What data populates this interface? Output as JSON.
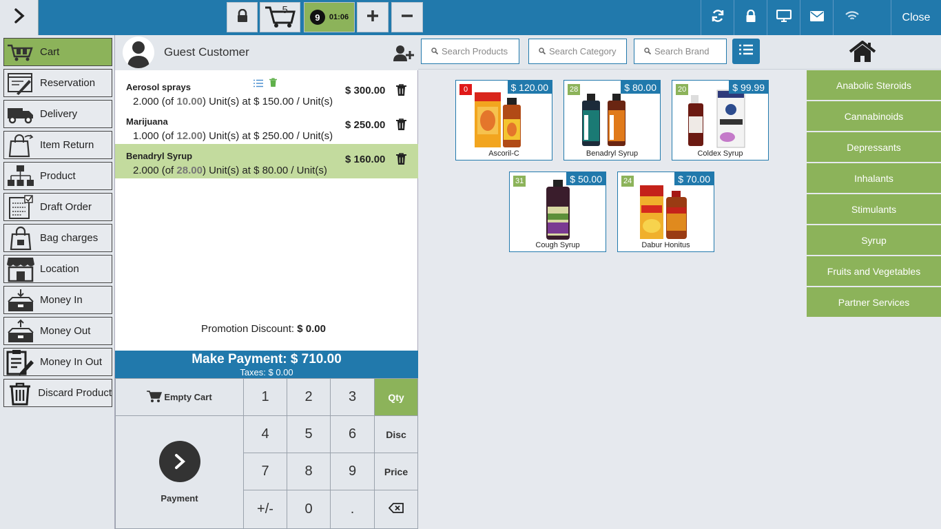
{
  "topbar": {
    "cart_count": "5",
    "timer_badge": "9",
    "timer_time": "01:06",
    "close_label": "Close"
  },
  "sidebar": {
    "items": [
      {
        "label": "Cart"
      },
      {
        "label": "Reservation"
      },
      {
        "label": "Delivery"
      },
      {
        "label": "Item Return"
      },
      {
        "label": "Product"
      },
      {
        "label": "Draft Order"
      },
      {
        "label": "Bag charges"
      },
      {
        "label": "Location"
      },
      {
        "label": "Money In"
      },
      {
        "label": "Money Out"
      },
      {
        "label": "Money In Out"
      },
      {
        "label": "Discard Product"
      }
    ]
  },
  "customer": {
    "name": "Guest Customer"
  },
  "cart": {
    "lines": [
      {
        "name": "Aerosol sprays",
        "qty": "2.000",
        "of_pre": " (of ",
        "avail": "10.00",
        "of_post": ") Unit(s) at $ 150.00 / Unit(s)",
        "total": "$ 300.00"
      },
      {
        "name": "Marijuana",
        "qty": "1.000",
        "of_pre": " (of ",
        "avail": "12.00",
        "of_post": ") Unit(s) at $ 250.00 / Unit(s)",
        "total": "$ 250.00"
      },
      {
        "name": "Benadryl Syrup",
        "qty": "2.000",
        "of_pre": " (of ",
        "avail": "28.00",
        "of_post": ") Unit(s) at $ 80.00 / Unit(s)",
        "total": "$ 160.00"
      }
    ],
    "promo_label": "Promotion Discount:",
    "promo_value": "$ 0.00",
    "make_payment": "Make Payment: $ 710.00",
    "taxes": "Taxes: $ 0.00"
  },
  "keypad": {
    "empty_cart": "Empty Cart",
    "payment": "Payment",
    "k1": "1",
    "k2": "2",
    "k3": "3",
    "k4": "4",
    "k5": "5",
    "k6": "6",
    "k7": "7",
    "k8": "8",
    "k9": "9",
    "kpm": "+/-",
    "k0": "0",
    "kdot": ".",
    "qty": "Qty",
    "disc": "Disc",
    "price": "Price"
  },
  "search": {
    "products": "Search Products",
    "category": "Search Category",
    "brand": "Search Brand"
  },
  "products": [
    {
      "name": "Ascoril-C",
      "price": "$ 120.00",
      "stock": "0"
    },
    {
      "name": "Benadryl Syrup",
      "price": "$ 80.00",
      "stock": "28"
    },
    {
      "name": "Coldex Syrup",
      "price": "$ 99.99",
      "stock": "20"
    },
    {
      "name": "Cough Syrup",
      "price": "$ 50.00",
      "stock": "31"
    },
    {
      "name": "Dabur Honitus",
      "price": "$ 70.00",
      "stock": "24"
    }
  ],
  "categories": [
    "Anabolic Steroids",
    "Cannabinoids",
    "Depressants",
    "Inhalants",
    "Stimulants",
    "Syrup",
    "Fruits and Vegetables",
    "Partner Services"
  ],
  "colors": {
    "brand_blue": "#2179ac",
    "accent_green": "#8cb35a",
    "selected_row": "#c3db9e",
    "out_of_stock": "#e01818"
  }
}
